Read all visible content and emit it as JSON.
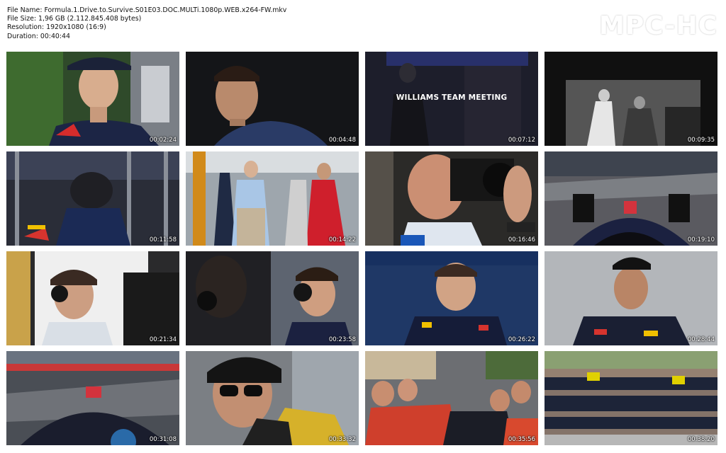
{
  "file_info": {
    "name": "File Name: Formula.1.Drive.to.Survive.S01E03.DOC.MULTi.1080p.WEB.x264-FW.mkv",
    "size": "File Size: 1,96 GB (2.112.845.408 bytes)",
    "resolution": "Resolution: 1920x1080 (16:9)",
    "duration": "Duration: 00:40:44"
  },
  "logo": "MPC-HC",
  "thumbnails": [
    {
      "time": "00:02:24"
    },
    {
      "time": "00:04:48"
    },
    {
      "time": "00:07:12",
      "caption": "WILLIAMS TEAM MEETING"
    },
    {
      "time": "00:09:35"
    },
    {
      "time": "00:11:58"
    },
    {
      "time": "00:14:22"
    },
    {
      "time": "00:16:46"
    },
    {
      "time": "00:19:10"
    },
    {
      "time": "00:21:34"
    },
    {
      "time": "00:23:58"
    },
    {
      "time": "00:26:22"
    },
    {
      "time": "00:28:44"
    },
    {
      "time": "00:31:08"
    },
    {
      "time": "00:33:32"
    },
    {
      "time": "00:35:56"
    },
    {
      "time": "00:38:20"
    }
  ]
}
